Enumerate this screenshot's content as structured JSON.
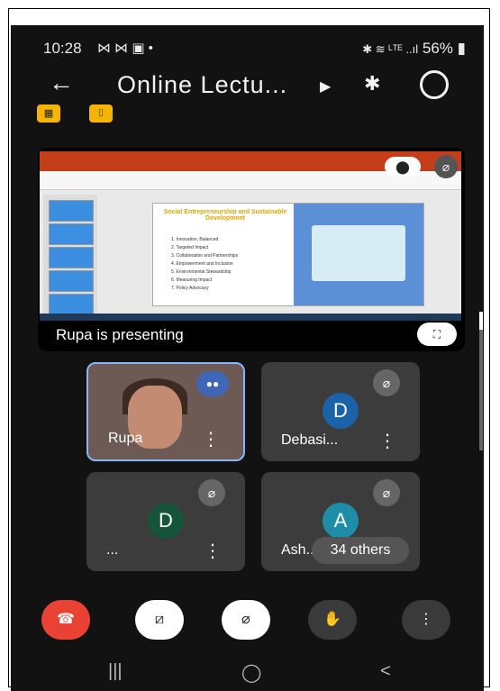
{
  "status": {
    "time": "10:28",
    "notif_icons": "⋈ ⋈ ▣ •",
    "battery": "56%",
    "signal": "✱ ≋ ᴸᵀᴱ ..ıl"
  },
  "meeting": {
    "title": "Online Lectu...",
    "presenter_label": "Rupa is presenting"
  },
  "slide": {
    "title": "Social Entrepreneurship and Sustainable Development",
    "items": [
      "1. Innovation, Balanced",
      "2. Targeted Impact",
      "3. Collaboration and Partnerships",
      "4. Empowerment and Inclusion",
      "5. Environmental Stewardship",
      "6. Measuring Impact",
      "7. Policy Advocacy"
    ]
  },
  "participants": [
    {
      "name": "Rupa",
      "initial": "",
      "speaking": true
    },
    {
      "name": "Debasi...",
      "initial": "D",
      "color": "#1b62a8"
    },
    {
      "name": "...",
      "initial": "D",
      "color": "#17553a"
    },
    {
      "name": "Ash...",
      "initial": "A",
      "color": "#1e8ea8"
    }
  ],
  "others_label": "34 others",
  "controls": {
    "end_call": "☎",
    "camera_off": "⧄",
    "mic_off": "⌀",
    "raise_hand": "✋",
    "more": "⋮"
  },
  "nav": {
    "recents": "|||",
    "home": "◯",
    "back": "<"
  },
  "colors": {
    "end_call": "#e94235",
    "tile_bg": "#3c3c3c",
    "accent": "#8ab4f8",
    "chip": "#f4b400"
  }
}
